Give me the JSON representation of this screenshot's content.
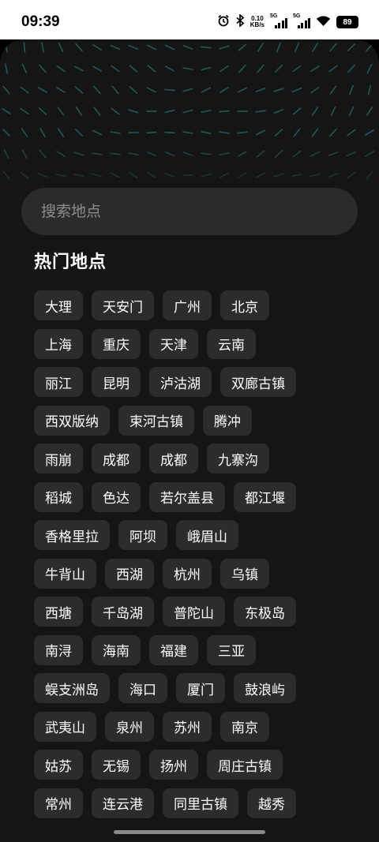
{
  "status_bar": {
    "time": "09:39",
    "net_speed_value": "0.10",
    "net_speed_unit": "KB/s",
    "sim1_gen": "5G",
    "sim2_gen": "5G",
    "battery": "89",
    "icons": [
      "alarm-icon",
      "bluetooth-icon",
      "signal-icon",
      "signal-icon",
      "wifi-icon",
      "battery-icon"
    ]
  },
  "search": {
    "placeholder": "搜索地点"
  },
  "section_title": "热门地点",
  "colors": {
    "background": "#151515",
    "chip": "#2c2c2c",
    "pattern": "#1d5a5a"
  },
  "rows": [
    [
      "大理",
      "天安门",
      "广州",
      "北京"
    ],
    [
      "上海",
      "重庆",
      "天津",
      "云南"
    ],
    [
      "丽江",
      "昆明",
      "泸沽湖",
      "双廊古镇"
    ],
    [
      "西双版纳",
      "束河古镇",
      "腾冲"
    ],
    [
      "雨崩",
      "成都",
      "成都",
      "九寨沟"
    ],
    [
      "稻城",
      "色达",
      "若尔盖县",
      "都江堰"
    ],
    [
      "香格里拉",
      "阿坝",
      "峨眉山"
    ],
    [
      "牛背山",
      "西湖",
      "杭州",
      "乌镇"
    ],
    [
      "西塘",
      "千岛湖",
      "普陀山",
      "东极岛"
    ],
    [
      "南浔",
      "海南",
      "福建",
      "三亚"
    ],
    [
      "蜈支洲岛",
      "海口",
      "厦门",
      "鼓浪屿"
    ],
    [
      "武夷山",
      "泉州",
      "苏州",
      "南京"
    ],
    [
      "姑苏",
      "无锡",
      "扬州",
      "周庄古镇"
    ],
    [
      "常州",
      "连云港",
      "同里古镇",
      "越秀"
    ]
  ]
}
